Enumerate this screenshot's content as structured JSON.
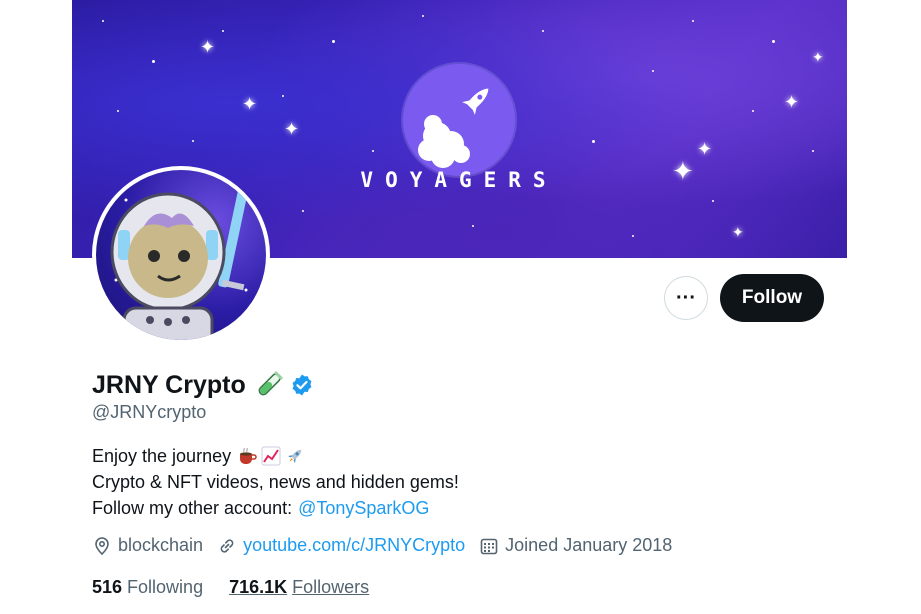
{
  "banner": {
    "brand_text": "VOYAGERS"
  },
  "profile": {
    "name": "JRNY Crypto",
    "handle": "@JRNYcrypto",
    "bio_line1": "Enjoy the journey",
    "bio_line2": "Crypto & NFT videos, news and hidden gems!",
    "bio_line3_prefix": "Follow my other account:",
    "bio_line3_link": "@TonySparkOG",
    "location": "blockchain",
    "website": "youtube.com/c/JRNYCrypto",
    "joined": "Joined January 2018",
    "following_count": "516",
    "following_label": "Following",
    "followers_count": "716.1K",
    "followers_label": "Followers"
  },
  "actions": {
    "more_label": "···",
    "follow_label": "Follow"
  },
  "icons": {
    "location": "location-pin-icon",
    "website": "link-icon",
    "joined": "calendar-icon",
    "verified": "verified-badge-icon",
    "name_emoji": "test-tube-emoji",
    "bio_emojis": [
      "coffee-emoji",
      "chart-increasing-emoji",
      "rocket-emoji"
    ]
  },
  "colors": {
    "accent": "#1d9bf0",
    "follow_bg": "#0f1419",
    "banner": "#3b22b8",
    "logo": "#7b5bef"
  }
}
